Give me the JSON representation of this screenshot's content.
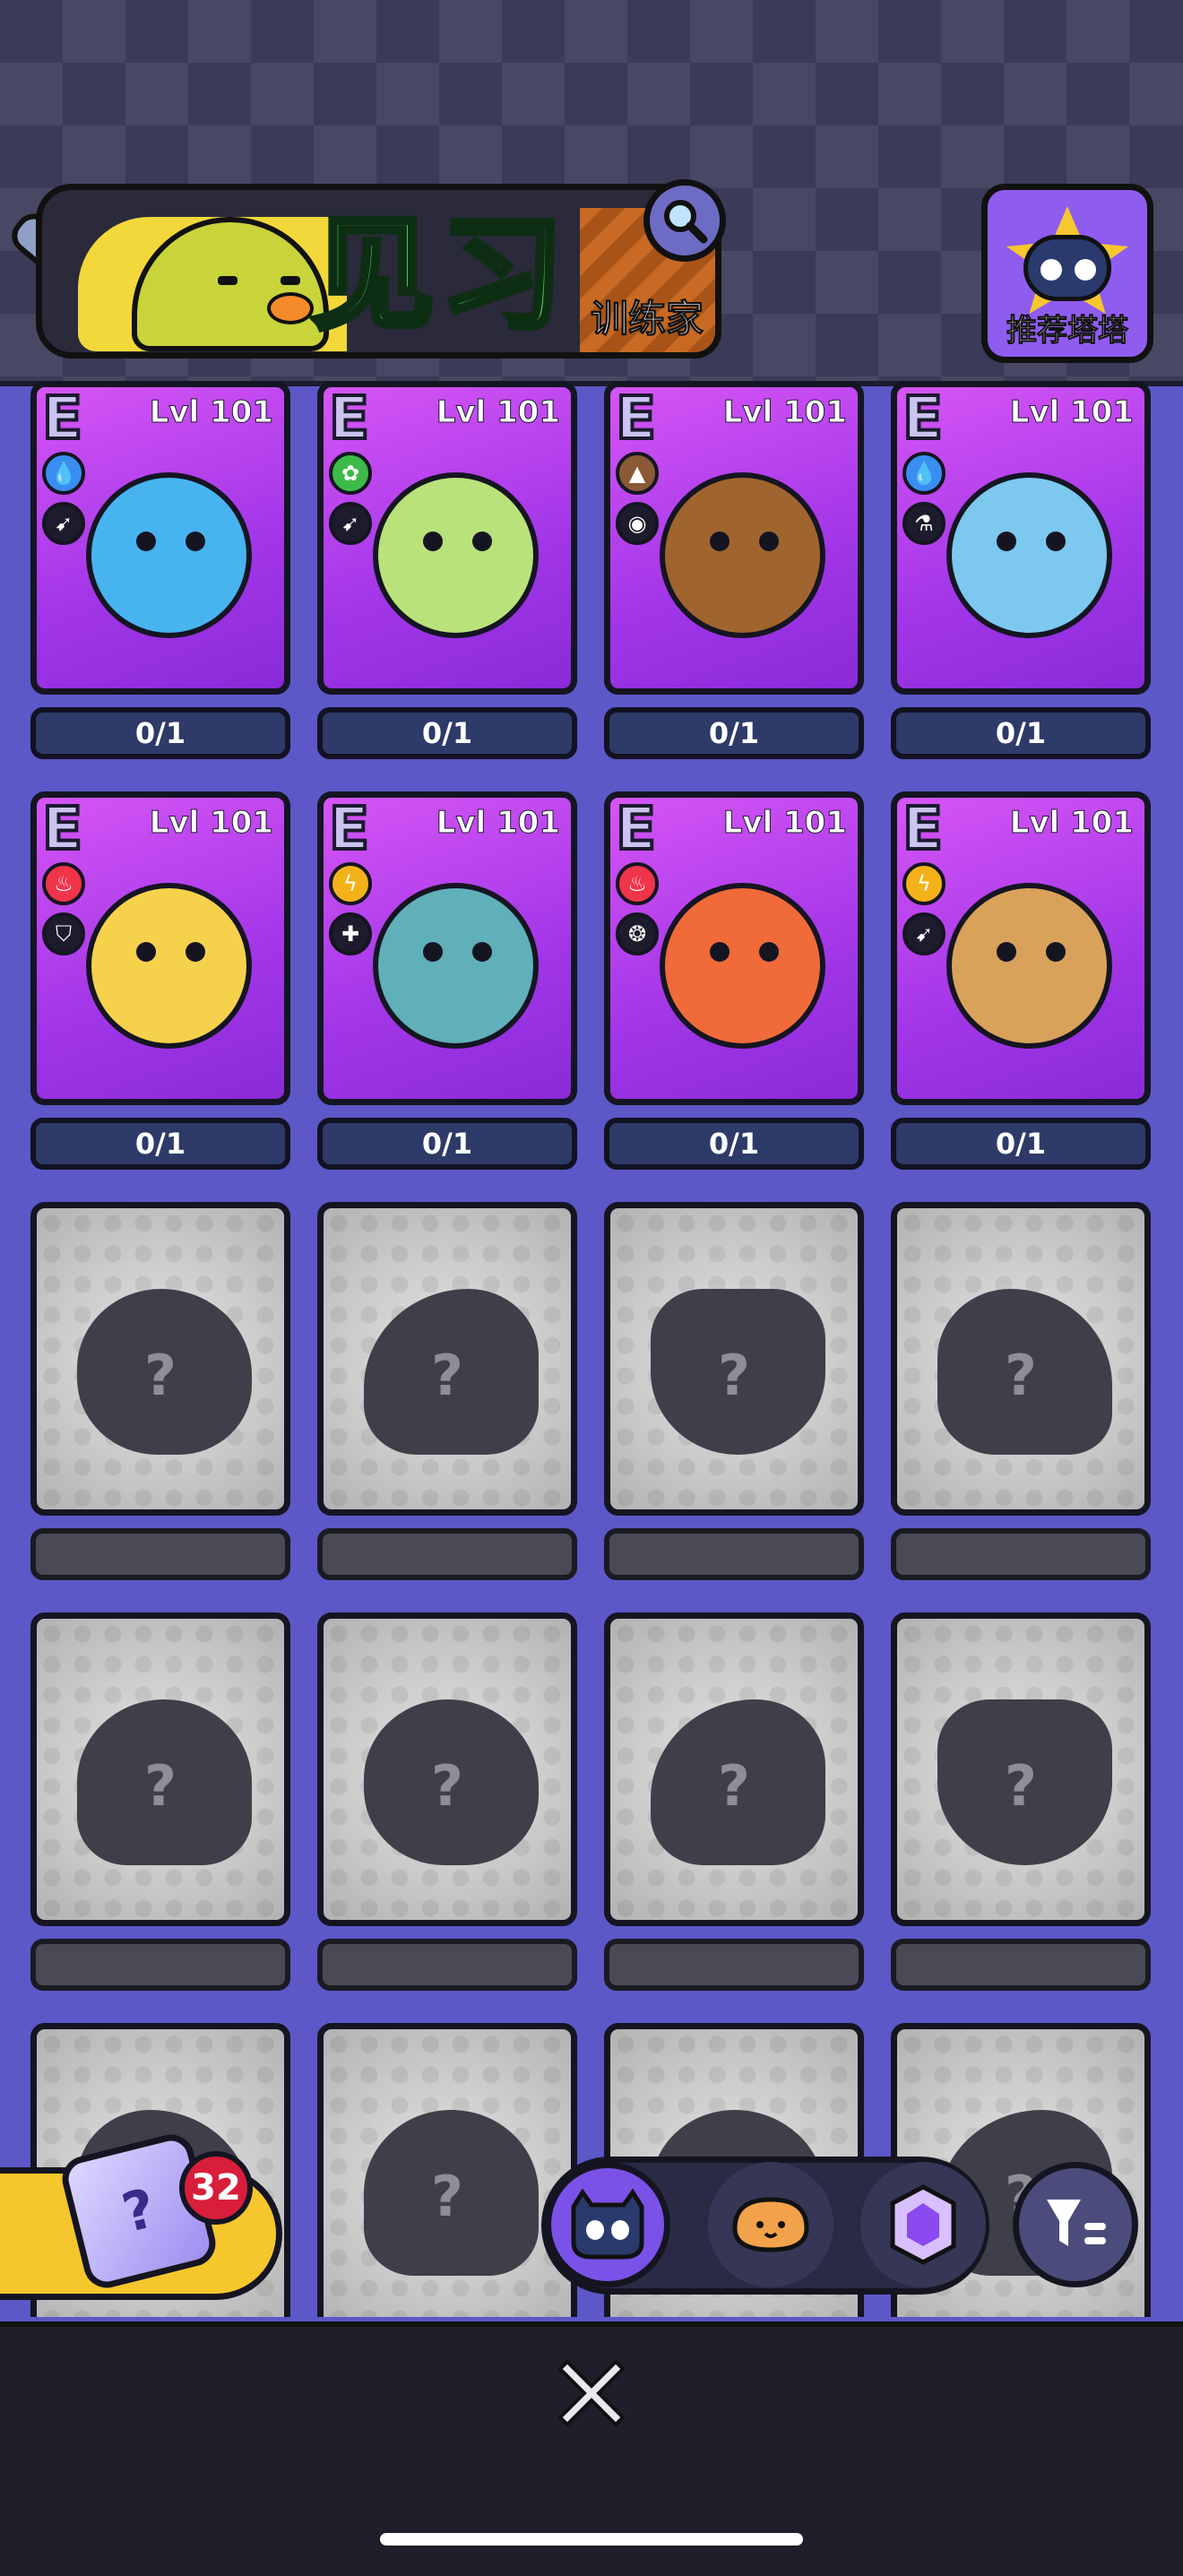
{
  "header": {
    "title": "见习",
    "subtitle": "训练家",
    "recommend_label": "推荐塔塔"
  },
  "cards": [
    {
      "rarity": "E",
      "level": "Lvl 101",
      "progress": "0/1",
      "type_icon": "water-drop-icon",
      "role_icon": "attack-icon",
      "color": "#47b4f0"
    },
    {
      "rarity": "E",
      "level": "Lvl 101",
      "progress": "0/1",
      "type_icon": "leaf-icon",
      "role_icon": "attack-icon",
      "color": "#b9e27a"
    },
    {
      "rarity": "E",
      "level": "Lvl 101",
      "progress": "0/1",
      "type_icon": "rock-icon",
      "role_icon": "eye-icon",
      "color": "#a0652e"
    },
    {
      "rarity": "E",
      "level": "Lvl 101",
      "progress": "0/1",
      "type_icon": "water-drop-icon",
      "role_icon": "potion-icon",
      "color": "#7cc8ee"
    },
    {
      "rarity": "E",
      "level": "Lvl 101",
      "progress": "0/1",
      "type_icon": "flame-icon",
      "role_icon": "shield-icon",
      "color": "#f6d24c"
    },
    {
      "rarity": "E",
      "level": "Lvl 101",
      "progress": "0/1",
      "type_icon": "lightning-icon",
      "role_icon": "plus-icon",
      "color": "#5fb0b8"
    },
    {
      "rarity": "E",
      "level": "Lvl 101",
      "progress": "0/1",
      "type_icon": "flame-icon",
      "role_icon": "spiral-icon",
      "color": "#f06a3a"
    },
    {
      "rarity": "E",
      "level": "Lvl 101",
      "progress": "0/1",
      "type_icon": "lightning-icon",
      "role_icon": "attack-icon",
      "color": "#d8a25a"
    }
  ],
  "unknown_cards": [
    {
      "mark": "?"
    },
    {
      "mark": "?"
    },
    {
      "mark": "?"
    },
    {
      "mark": "?"
    },
    {
      "mark": "?"
    },
    {
      "mark": "?"
    },
    {
      "mark": "?"
    },
    {
      "mark": "?"
    },
    {
      "mark": "?"
    },
    {
      "mark": "?"
    },
    {
      "mark": "?"
    },
    {
      "mark": "?"
    }
  ],
  "mystery_box": {
    "count": "32",
    "icon": "mystery-box-icon"
  },
  "filters": [
    {
      "icon": "robot-face-icon",
      "selected": true
    },
    {
      "icon": "bread-icon",
      "selected": false
    },
    {
      "icon": "gem-icon",
      "selected": false
    }
  ],
  "sort_icon": "filter-sort-icon",
  "close_icon": "close-icon",
  "colors": {
    "accent": "#7a52e8",
    "card_purple": "#b43ef0",
    "progress_bar": "#2e3a68"
  }
}
